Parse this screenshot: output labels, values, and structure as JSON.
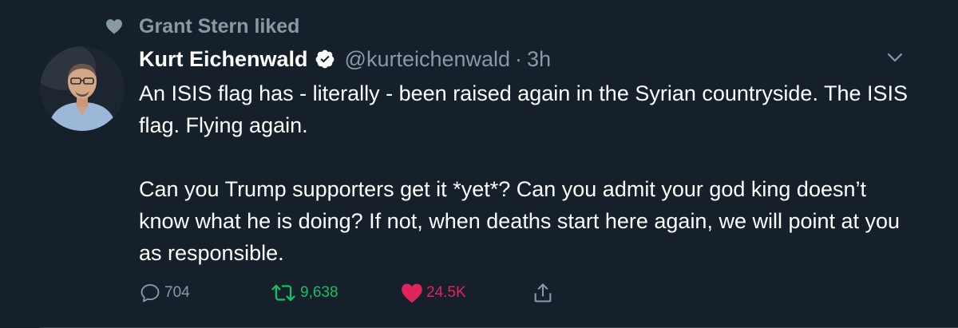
{
  "social_context": {
    "text": "Grant Stern liked",
    "icon": "heart-icon"
  },
  "tweet": {
    "author": {
      "display_name": "Kurt Eichenwald",
      "handle": "@kurteichenwald",
      "verified": true
    },
    "separator": "·",
    "time": "3h",
    "text_paragraph_1": "An ISIS flag has - literally - been raised again in the Syrian countryside. The ISIS flag. Flying again.",
    "text_paragraph_2": "Can you Trump supporters get it *yet*? Can you admit your god king doesn’t know what he is doing? If not, when deaths start here again, we will point at you as responsible.",
    "actions": {
      "reply_count": "704",
      "retweet_count": "9,638",
      "like_count": "24.5K"
    }
  },
  "colors": {
    "background": "#15202b",
    "secondary_text": "#8899a6",
    "verified": "#ffffff",
    "retweet_active": "#17bf63",
    "like_active": "#e0245e"
  }
}
